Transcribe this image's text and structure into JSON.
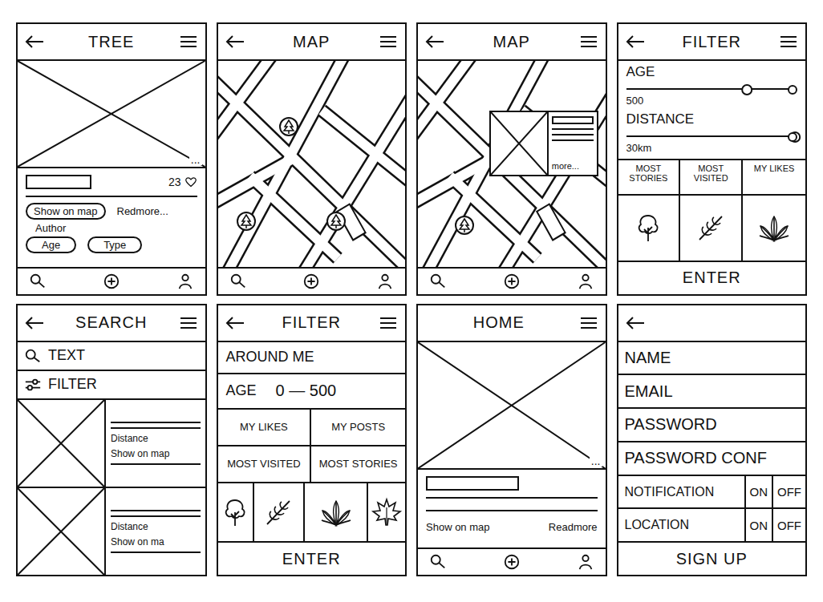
{
  "screens": [
    {
      "kind": "tree",
      "header": {
        "back": true,
        "title": "TREE",
        "menu": true
      },
      "more": "...",
      "likes": "23",
      "show_on_map": "Show on map",
      "read_more": "Redmore...",
      "author": "Author",
      "tags": [
        "Age",
        "Type"
      ],
      "nav": true
    },
    {
      "kind": "map",
      "header": {
        "back": true,
        "title": "MAP",
        "menu": true
      },
      "nav": true
    },
    {
      "kind": "map-popup",
      "header": {
        "back": true,
        "title": "MAP",
        "menu": true
      },
      "popup": {
        "more": "more..."
      },
      "nav": true
    },
    {
      "kind": "filter-sliders",
      "header": {
        "back": true,
        "title": "FILTER",
        "menu": true
      },
      "sliders": [
        {
          "label": "AGE",
          "level": 0.72,
          "reading": "500"
        },
        {
          "label": "DISTANCE",
          "level": 1,
          "reading": "30km"
        }
      ],
      "tabs": [
        "MOST STORIES",
        "MOST VISITED",
        "MY LIKES"
      ],
      "enter": "ENTER"
    },
    {
      "kind": "search",
      "header": {
        "back": true,
        "title": "SEARCH",
        "menu": true
      },
      "search": "TEXT",
      "filter": "FILTER",
      "results": [
        {
          "distance": "Distance",
          "show_on_map": "Show on map"
        },
        {
          "distance": "Distance",
          "show_on_map": "Show on ma"
        }
      ]
    },
    {
      "kind": "filter-grid",
      "header": {
        "back": true,
        "title": "FILTER",
        "menu": true
      },
      "around": "AROUND ME",
      "age": {
        "label": "AGE",
        "range": "0 — 500"
      },
      "options": [
        "MY LIKES",
        "MY POSTS",
        "MOST VISITED",
        "MOST STORIES"
      ],
      "enter": "ENTER"
    },
    {
      "kind": "home",
      "header": {
        "back": false,
        "title": "HOME",
        "menu": true
      },
      "more": "...",
      "show_on_map": "Show on map",
      "read_more": "Readmore",
      "nav": true
    },
    {
      "kind": "signup",
      "header": {
        "back": true,
        "menu": false
      },
      "fields": [
        "NAME",
        "EMAIL",
        "PASSWORD",
        "PASSWORD CONF"
      ],
      "toggles": [
        {
          "label": "NOTIFICATION",
          "on": "ON",
          "off": "OFF"
        },
        {
          "label": "LOCATION",
          "on": "ON",
          "off": "OFF"
        }
      ],
      "submit": "SIGN UP"
    }
  ]
}
